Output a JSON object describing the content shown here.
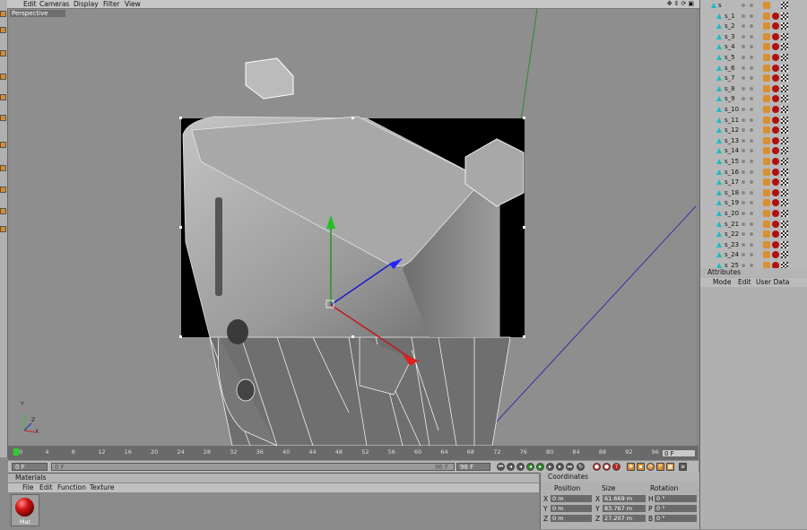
{
  "menu": {
    "items": [
      "Edit",
      "Cameras",
      "Display",
      "Filter",
      "View"
    ]
  },
  "viewport": {
    "label": "Perspective"
  },
  "timeline": {
    "ticks": [
      "0",
      "4",
      "8",
      "12",
      "16",
      "20",
      "24",
      "28",
      "32",
      "36",
      "40",
      "44",
      "48",
      "52",
      "56",
      "60",
      "64",
      "68",
      "72",
      "76",
      "80",
      "84",
      "88",
      "92",
      "96"
    ],
    "end_frame": "0 F"
  },
  "transport": {
    "current_frame": "0 F",
    "min_frame": "0 F",
    "max_frame_small": "96 F",
    "max_frame": "96 F"
  },
  "materials": {
    "title": "Materials",
    "menu": [
      "File",
      "Edit",
      "Function",
      "Texture"
    ],
    "material_name": "Mat"
  },
  "coordinates": {
    "title": "Coordinates",
    "headers": [
      "Position",
      "Size",
      "Rotation"
    ],
    "rows": [
      {
        "axis": "X",
        "pos": "0 m",
        "size_axis": "X",
        "size": "61.669 m",
        "rot_axis": "H",
        "rot": "0 °"
      },
      {
        "axis": "Y",
        "pos": "0 m",
        "size_axis": "Y",
        "size": "83.767 m",
        "rot_axis": "P",
        "rot": "0 °"
      },
      {
        "axis": "Z",
        "pos": "0 m",
        "size_axis": "Z",
        "size": "27.207 m",
        "rot_axis": "B",
        "rot": "0 °"
      }
    ]
  },
  "objects": {
    "root": "s",
    "items": [
      "s_1",
      "s_2",
      "s_3",
      "s_4",
      "s_5",
      "s_6",
      "s_7",
      "s_8",
      "s_9",
      "s_10",
      "s_11",
      "s_12",
      "s_13",
      "s_14",
      "s_15",
      "s_16",
      "s_17",
      "s_18",
      "s_19",
      "s_20",
      "s_21",
      "s_22",
      "s_23",
      "s_24",
      "s_25"
    ]
  },
  "attributes": {
    "title": "Attributes",
    "menu": [
      "Mode",
      "Edit",
      "User Data"
    ]
  },
  "axis_labels": {
    "y": "Y",
    "z": "Z",
    "x": "X"
  },
  "colors": {
    "accent": "#d38c2e",
    "viewport": "#8e8e8e",
    "render_region": "#000000"
  }
}
